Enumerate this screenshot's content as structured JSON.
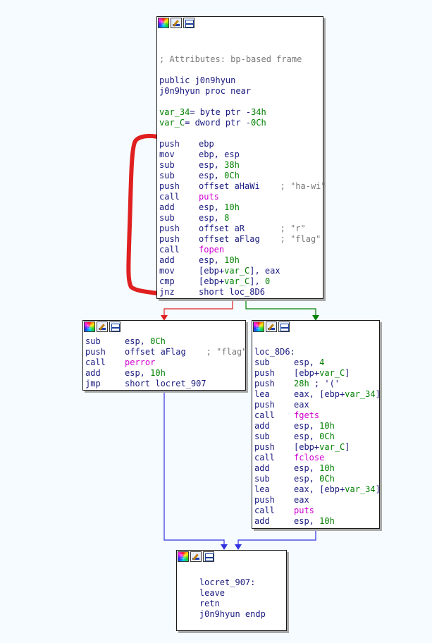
{
  "colors": {
    "background": "#f5fbff",
    "edge_false": "#e02020",
    "edge_true": "#008000",
    "edge_jump": "#3030e0",
    "annotation": "#e02020",
    "function_name": "#d000d0",
    "number": "#008000",
    "comment": "#7a7a7a",
    "text": "#1a1a80"
  },
  "toolbar_icons": [
    "color-palette-icon",
    "edit-pencil-icon",
    "graph-overview-icon"
  ],
  "blocks": {
    "entry": {
      "lines": [
        {
          "t": "; Attributes: bp-based frame",
          "k": "c"
        },
        {
          "t": ""
        },
        {
          "t": "public j0n9hyun"
        },
        {
          "t": "j0n9hyun proc near"
        },
        {
          "t": ""
        },
        {
          "t": "var_34= byte ptr -34h",
          "h": "var"
        },
        {
          "t": "var_C= dword ptr -0Ch",
          "h": "var"
        },
        {
          "t": ""
        },
        {
          "m": "push",
          "o": "ebp"
        },
        {
          "m": "mov",
          "o": "ebp, esp"
        },
        {
          "m": "sub",
          "o": "esp, 38h",
          "n": true
        },
        {
          "m": "sub",
          "o": "esp, 0Ch",
          "n": true
        },
        {
          "m": "push",
          "o": "offset aHaWi    ",
          "cm": "; \"ha-wi\""
        },
        {
          "m": "call",
          "o": "puts",
          "f": true
        },
        {
          "m": "add",
          "o": "esp, 10h",
          "n": true
        },
        {
          "m": "sub",
          "o": "esp, 8",
          "n": true
        },
        {
          "m": "push",
          "o": "offset aR       ",
          "cm": "; \"r\""
        },
        {
          "m": "push",
          "o": "offset aFlag    ",
          "cm": "; \"flag\""
        },
        {
          "m": "call",
          "o": "fopen",
          "f": true
        },
        {
          "m": "add",
          "o": "esp, 10h",
          "n": true
        },
        {
          "m": "mov",
          "o": "[ebp+var_C], eax"
        },
        {
          "m": "cmp",
          "o": "[ebp+var_C], 0"
        },
        {
          "m": "jnz",
          "o": "short loc_8D6"
        }
      ]
    },
    "left": {
      "lines": [
        {
          "m": "sub",
          "o": "esp, 0Ch",
          "n": true
        },
        {
          "m": "push",
          "o": "offset aFlag    ",
          "cm": "; \"flag\""
        },
        {
          "m": "call",
          "o": "perror",
          "f": true
        },
        {
          "m": "add",
          "o": "esp, 10h",
          "n": true
        },
        {
          "m": "jmp",
          "o": "short locret_907"
        }
      ]
    },
    "right": {
      "lines": [
        {
          "t": ""
        },
        {
          "t": "loc_8D6:"
        },
        {
          "m": "sub",
          "o": "esp, 4",
          "n": true
        },
        {
          "m": "push",
          "o": "[ebp+var_C]"
        },
        {
          "m": "push",
          "o": "28h ; '('",
          "n": true
        },
        {
          "m": "lea",
          "o": "eax, [ebp+var_34]"
        },
        {
          "m": "push",
          "o": "eax"
        },
        {
          "m": "call",
          "o": "fgets",
          "f": true
        },
        {
          "m": "add",
          "o": "esp, 10h",
          "n": true
        },
        {
          "m": "sub",
          "o": "esp, 0Ch",
          "n": true
        },
        {
          "m": "push",
          "o": "[ebp+var_C]"
        },
        {
          "m": "call",
          "o": "fclose",
          "f": true
        },
        {
          "m": "add",
          "o": "esp, 10h",
          "n": true
        },
        {
          "m": "sub",
          "o": "esp, 0Ch",
          "n": true
        },
        {
          "m": "lea",
          "o": "eax, [ebp+var_34]"
        },
        {
          "m": "push",
          "o": "eax"
        },
        {
          "m": "call",
          "o": "puts",
          "f": true
        },
        {
          "m": "add",
          "o": "esp, 10h",
          "n": true
        }
      ]
    },
    "exit": {
      "lines": [
        {
          "t": "    locret_907:"
        },
        {
          "t": "    leave"
        },
        {
          "t": "    retn"
        },
        {
          "t": "    j0n9hyun endp"
        }
      ]
    }
  }
}
